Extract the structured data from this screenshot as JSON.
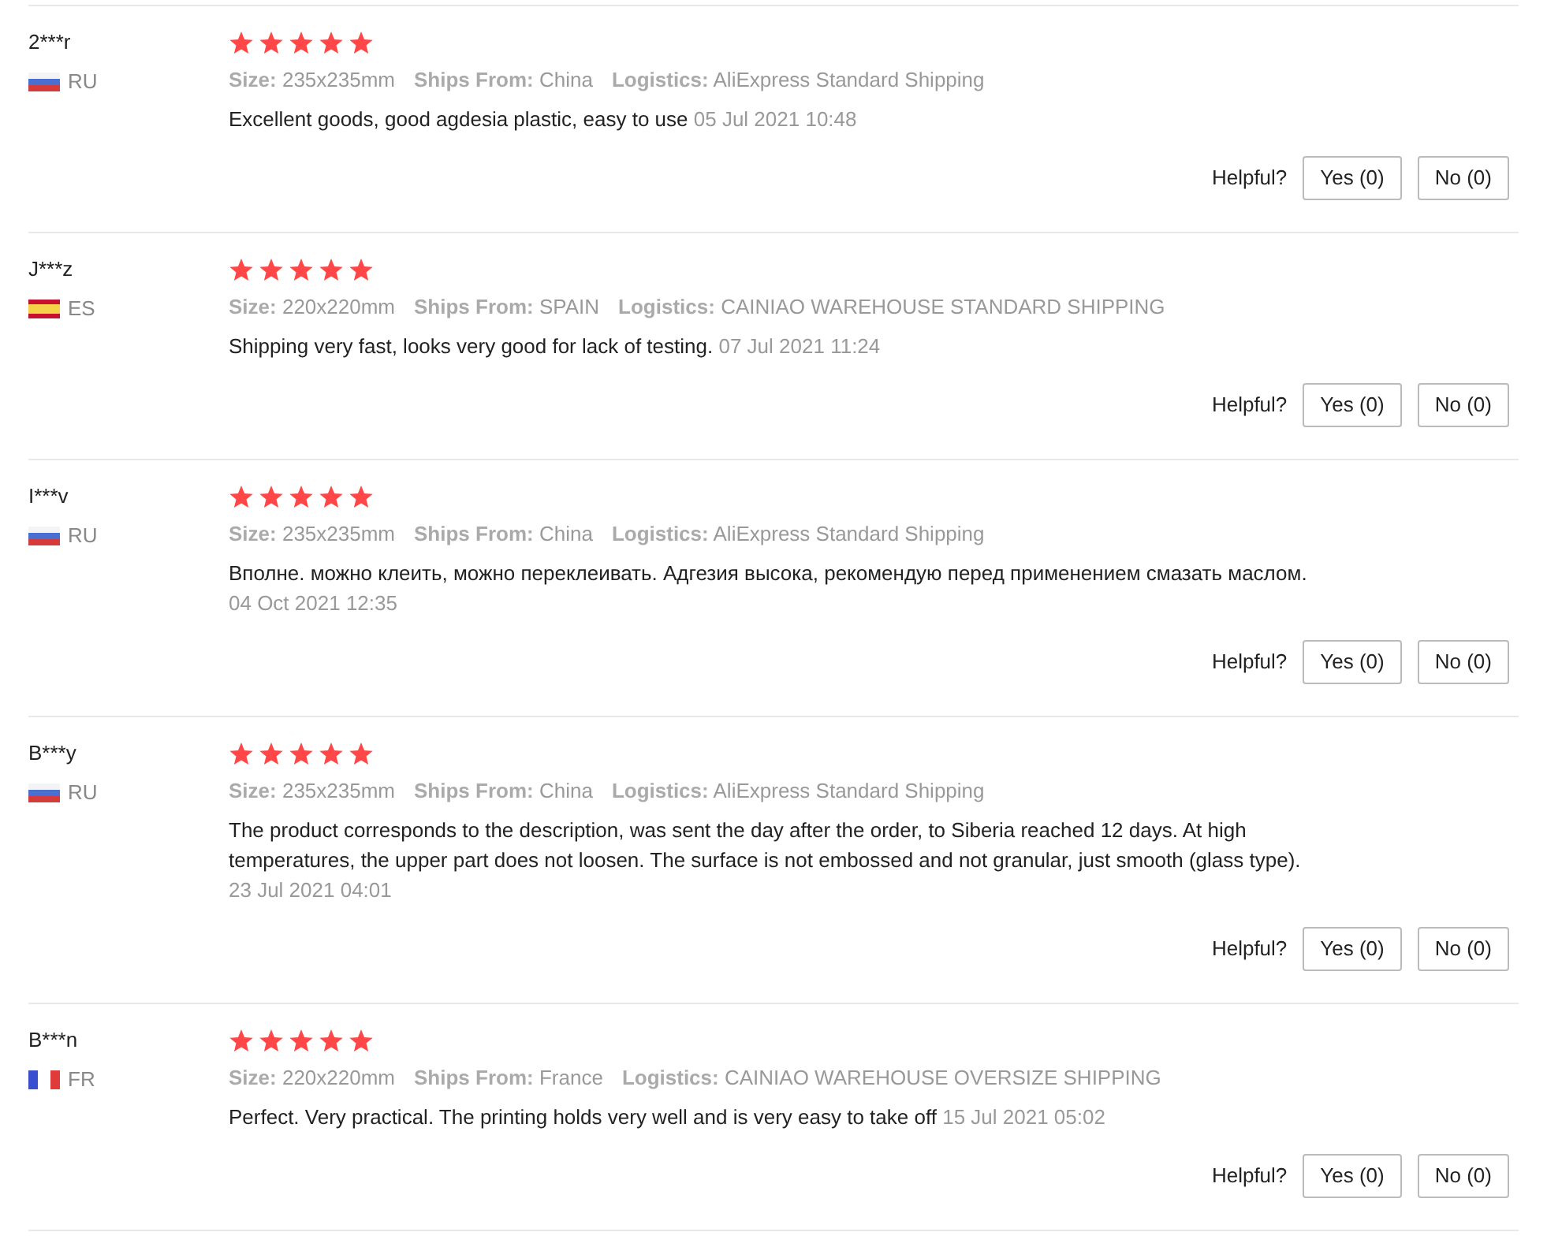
{
  "reviews": [
    {
      "user": "2***r",
      "kind": "ru",
      "country": "RU",
      "stars": 5,
      "size_label": "Size:",
      "size": "235x235mm",
      "ships_label": "Ships From:",
      "ships_from": "China",
      "logistics_label": "Logistics:",
      "logistics": "AliExpress Standard Shipping",
      "text": "Excellent goods, good agdesia plastic, easy to use",
      "date": "05 Jul 2021 10:48",
      "helpful_label": "Helpful?",
      "yes": "Yes (0)",
      "no": "No (0)"
    },
    {
      "user": "J***z",
      "kind": "es",
      "country": "ES",
      "stars": 5,
      "size_label": "Size:",
      "size": "220x220mm",
      "ships_label": "Ships From:",
      "ships_from": "SPAIN",
      "logistics_label": "Logistics:",
      "logistics": "CAINIAO WAREHOUSE STANDARD SHIPPING",
      "text": "Shipping very fast, looks very good for lack of testing.",
      "date": "07 Jul 2021 11:24",
      "helpful_label": "Helpful?",
      "yes": "Yes (0)",
      "no": "No (0)"
    },
    {
      "user": "I***v",
      "kind": "ru",
      "country": "RU",
      "stars": 5,
      "size_label": "Size:",
      "size": "235x235mm",
      "ships_label": "Ships From:",
      "ships_from": "China",
      "logistics_label": "Logistics:",
      "logistics": "AliExpress Standard Shipping",
      "text": "Вполне. можно клеить, можно переклеивать. Адгезия высока, рекомендую перед применением смазать маслом.",
      "date": "04 Oct 2021 12:35",
      "helpful_label": "Helpful?",
      "yes": "Yes (0)",
      "no": "No (0)"
    },
    {
      "user": "B***y",
      "kind": "ru",
      "country": "RU",
      "stars": 5,
      "size_label": "Size:",
      "size": "235x235mm",
      "ships_label": "Ships From:",
      "ships_from": "China",
      "logistics_label": "Logistics:",
      "logistics": "AliExpress Standard Shipping",
      "text": "The product corresponds to the description, was sent the day after the order, to Siberia reached 12 days. At high temperatures, the upper part does not loosen. The surface is not embossed and not granular, just smooth (glass type).",
      "date": "23 Jul 2021 04:01",
      "helpful_label": "Helpful?",
      "yes": "Yes (0)",
      "no": "No (0)"
    },
    {
      "user": "B***n",
      "kind": "fr",
      "country": "FR",
      "stars": 5,
      "size_label": "Size:",
      "size": "220x220mm",
      "ships_label": "Ships From:",
      "ships_from": "France",
      "logistics_label": "Logistics:",
      "logistics": "CAINIAO WAREHOUSE OVERSIZE SHIPPING",
      "text": "Perfect. Very practical. The printing holds very well and is very easy to take off",
      "date": "15 Jul 2021 05:02",
      "helpful_label": "Helpful?",
      "yes": "Yes (0)",
      "no": "No (0)"
    }
  ]
}
